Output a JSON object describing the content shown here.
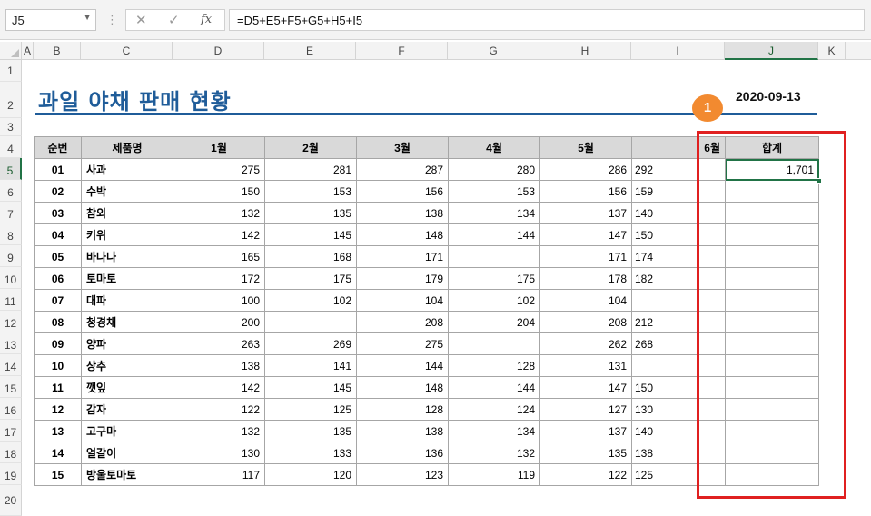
{
  "formula_bar": {
    "name_box": "J5",
    "formula": "=D5+E5+F5+G5+H5+I5",
    "cancel_icon": "cancel-icon",
    "enter_icon": "check-icon",
    "fx_label": "fx"
  },
  "columns": [
    "A",
    "B",
    "C",
    "D",
    "E",
    "F",
    "G",
    "H",
    "I",
    "J",
    "K"
  ],
  "rows": [
    "1",
    "2",
    "3",
    "4",
    "5",
    "6",
    "7",
    "8",
    "9",
    "10",
    "11",
    "12",
    "13",
    "14",
    "15",
    "16",
    "17",
    "18",
    "19",
    "20"
  ],
  "title": "과일 야채 판매 현황",
  "date": "2020-09-13",
  "badge": "1",
  "table": {
    "headers": [
      "순번",
      "제품명",
      "1월",
      "2월",
      "3월",
      "4월",
      "5월",
      "6월",
      "합계"
    ],
    "rows": [
      {
        "no": "01",
        "name": "사과",
        "v": [
          "275",
          "281",
          "287",
          "280",
          "286",
          "292"
        ],
        "sum": "1,701"
      },
      {
        "no": "02",
        "name": "수박",
        "v": [
          "150",
          "153",
          "156",
          "153",
          "156",
          "159"
        ],
        "sum": ""
      },
      {
        "no": "03",
        "name": "참외",
        "v": [
          "132",
          "135",
          "138",
          "134",
          "137",
          "140"
        ],
        "sum": ""
      },
      {
        "no": "04",
        "name": "키위",
        "v": [
          "142",
          "145",
          "148",
          "144",
          "147",
          "150"
        ],
        "sum": ""
      },
      {
        "no": "05",
        "name": "바나나",
        "v": [
          "165",
          "168",
          "171",
          "",
          "171",
          "174"
        ],
        "sum": ""
      },
      {
        "no": "06",
        "name": "토마토",
        "v": [
          "172",
          "175",
          "179",
          "175",
          "178",
          "182"
        ],
        "sum": ""
      },
      {
        "no": "07",
        "name": "대파",
        "v": [
          "100",
          "102",
          "104",
          "102",
          "104",
          ""
        ],
        "sum": ""
      },
      {
        "no": "08",
        "name": "청경채",
        "v": [
          "200",
          "",
          "208",
          "204",
          "208",
          "212"
        ],
        "sum": ""
      },
      {
        "no": "09",
        "name": "양파",
        "v": [
          "263",
          "269",
          "275",
          "",
          "262",
          "268"
        ],
        "sum": ""
      },
      {
        "no": "10",
        "name": "상추",
        "v": [
          "138",
          "141",
          "144",
          "128",
          "131",
          ""
        ],
        "sum": ""
      },
      {
        "no": "11",
        "name": "깻잎",
        "v": [
          "142",
          "145",
          "148",
          "144",
          "147",
          "150"
        ],
        "sum": ""
      },
      {
        "no": "12",
        "name": "감자",
        "v": [
          "122",
          "125",
          "128",
          "124",
          "127",
          "130"
        ],
        "sum": ""
      },
      {
        "no": "13",
        "name": "고구마",
        "v": [
          "132",
          "135",
          "138",
          "134",
          "137",
          "140"
        ],
        "sum": ""
      },
      {
        "no": "14",
        "name": "얼갈이",
        "v": [
          "130",
          "133",
          "136",
          "132",
          "135",
          "138"
        ],
        "sum": ""
      },
      {
        "no": "15",
        "name": "방울토마토",
        "v": [
          "117",
          "120",
          "123",
          "119",
          "122",
          "125"
        ],
        "sum": ""
      }
    ]
  },
  "colors": {
    "title": "#1f5c99",
    "selection": "#217346",
    "annotation_box": "#e02020",
    "badge": "#f28a30"
  }
}
